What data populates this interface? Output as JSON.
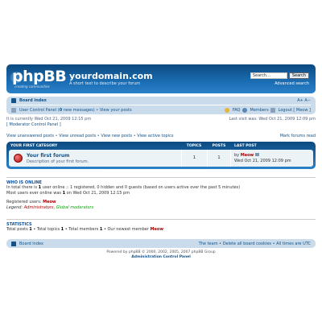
{
  "header": {
    "logo_text": "phpBB",
    "logo_tagline": "creating communities",
    "site_title": "yourdomain.com",
    "site_description": "A short text to describe your forum",
    "search_placeholder": "Search…",
    "search_button": "Search",
    "advanced_search": "Advanced search"
  },
  "navbar": {
    "breadcrumb": "Board index",
    "font_size": "A+ A−",
    "ucp": "User Control Panel",
    "messages_open": " (",
    "messages_count": "0",
    "messages_label": " new messages)",
    "sep1": " • ",
    "view_posts": "View your posts",
    "faq": "FAQ",
    "members": "Members",
    "logout": "Logout [ Meow ]"
  },
  "info": {
    "current_time": "It is currently Wed Oct 21, 2009 12:15 pm",
    "mcp": "[ Moderator Control Panel ]",
    "last_visit": "Last visit was: Wed Oct 21, 2009 12:09 pm"
  },
  "links": {
    "unanswered": "View unanswered posts",
    "unread": "View unread posts",
    "new_posts": "View new posts",
    "active": "View active topics",
    "mark_read": "Mark forums read",
    "sep": " • "
  },
  "forum_table": {
    "headers": {
      "category": "Your first category",
      "topics": "Topics",
      "posts": "Posts",
      "last_post": "Last post"
    },
    "rows": [
      {
        "title": "Your first forum",
        "description": "Description of your first forum.",
        "topics": "1",
        "posts": "1",
        "last_by": "by ",
        "last_user": "Meow",
        "last_date": "Wed Oct 21, 2009 12:09 pm"
      }
    ]
  },
  "who_is_online": {
    "title": "Who is online",
    "line1_pre": "In total there is ",
    "line1_num": "1",
    "line1_post": " user online :: 1 registered, 0 hidden and 0 guests (based on users active over the past 5 minutes)",
    "line2_pre": "Most users ever online was ",
    "line2_num": "1",
    "line2_post": " on Wed Oct 21, 2009 12:15 pm",
    "registered_label": "Registered users: ",
    "registered_user": "Meow",
    "legend_label": "Legend: ",
    "legend_admins": "Administrators",
    "legend_comma": ", ",
    "legend_mods": "Global moderators"
  },
  "statistics": {
    "title": "Statistics",
    "pre_posts": "Total posts ",
    "posts": "1",
    "pre_topics": " • Total topics ",
    "topics": "1",
    "pre_members": " • Total members ",
    "members": "1",
    "pre_newest": " • Our newest member ",
    "newest": "Meow"
  },
  "footer": {
    "board_index": "Board index",
    "links": "The team • Delete all board cookies • All times are UTC",
    "powered": "Powered by phpBB © 2000, 2002, 2005, 2007 phpBB Group",
    "acp": "Administration Control Panel"
  },
  "colors": {
    "header_blue": "#1b6db3",
    "navbar": "#cadceb",
    "row_bg": "#ecf3f7",
    "admin_red": "#aa0000",
    "mod_green": "#00aa00"
  }
}
